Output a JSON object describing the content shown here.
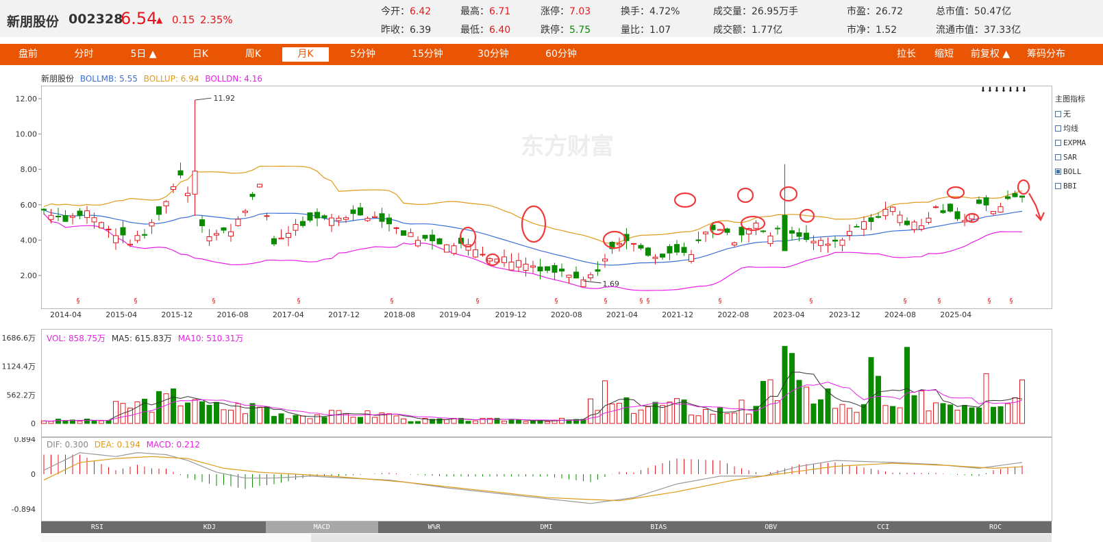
{
  "header": {
    "name": "新朋股份",
    "code": "002328",
    "price": "6.54",
    "arrow": "▲",
    "change": "0.15",
    "change_pct": "2.35%",
    "quotes": [
      {
        "label": "今开：",
        "value": "6.42",
        "color": "red"
      },
      {
        "label": "最高：",
        "value": "6.71",
        "color": "red"
      },
      {
        "label": "涨停：",
        "value": "7.03",
        "color": "red"
      },
      {
        "label": "换手：",
        "value": "4.72%",
        "color": "plain"
      },
      {
        "label": "成交量：",
        "value": "26.95万手",
        "color": "plain"
      },
      {
        "label": "市盈：",
        "value": "26.72",
        "color": "plain"
      },
      {
        "label": "总市值：",
        "value": "50.47亿",
        "color": "plain"
      },
      {
        "label": "昨收：",
        "value": "6.39",
        "color": "plain"
      },
      {
        "label": "最低：",
        "value": "6.40",
        "color": "red"
      },
      {
        "label": "跌停：",
        "value": "5.75",
        "color": "green"
      },
      {
        "label": "量比：",
        "value": "1.07",
        "color": "plain"
      },
      {
        "label": "成交额：",
        "value": "1.77亿",
        "color": "plain"
      },
      {
        "label": "市净：",
        "value": "1.52",
        "color": "plain"
      },
      {
        "label": "流通市值：",
        "value": "37.33亿",
        "color": "plain"
      }
    ]
  },
  "tabs": [
    "盘前",
    "分时",
    "5日 ▲",
    "日K",
    "周K",
    "月K",
    "5分钟",
    "15分钟",
    "30分钟",
    "60分钟"
  ],
  "active_tab": "月K",
  "right_tabs": [
    "拉长",
    "缩短",
    "前复权 ▲",
    "筹码分布"
  ],
  "main_legend": {
    "name": "新朋股份",
    "mb": "BOLLMB: 5.55",
    "up": "BOLLUP: 6.94",
    "dn": "BOLLDN: 4.16"
  },
  "watermark": "东方财富",
  "main_chart": {
    "y_ticks": [
      "12.00",
      "10.00",
      "8.00",
      "6.00",
      "4.00",
      "2.00"
    ],
    "x_ticks": [
      "2014-04",
      "2015-04",
      "2015-12",
      "2016-08",
      "2017-04",
      "2017-12",
      "2018-08",
      "2019-04",
      "2019-12",
      "2020-08",
      "2021-04",
      "2021-12",
      "2022-08",
      "2023-04",
      "2023-12",
      "2024-08",
      "2025-04"
    ],
    "high_label": "11.92",
    "low_label": "1.69"
  },
  "indicator_panel": {
    "title": "主图指标",
    "items": [
      {
        "label": "无",
        "checked": false
      },
      {
        "label": "均线",
        "checked": false
      },
      {
        "label": "EXPMA",
        "checked": false
      },
      {
        "label": "SAR",
        "checked": false
      },
      {
        "label": "BOLL",
        "checked": true
      },
      {
        "label": "BBI",
        "checked": false
      }
    ]
  },
  "vol_legend": {
    "vol": "VOL: 858.75万",
    "ma5": "MA5: 615.83万",
    "ma10": "MA10: 510.31万"
  },
  "vol_chart": {
    "y_ticks": [
      "1686.6万",
      "1124.4万",
      "562.2万",
      "0"
    ]
  },
  "macd_legend": {
    "dif": "DIF: 0.300",
    "dea": "DEA: 0.194",
    "macd": "MACD: 0.212"
  },
  "macd_chart": {
    "y_ticks": [
      "0.894",
      "0",
      "-0.894"
    ]
  },
  "indicator_tabs": [
    "RSI",
    "KDJ",
    "MACD",
    "W%R",
    "DMI",
    "BIAS",
    "OBV",
    "CCI",
    "ROC"
  ],
  "active_indicator": "MACD",
  "colors": {
    "up": "#e3171d",
    "down": "#0b8a00",
    "mb": "#3b6fd6",
    "up_band": "#e09a1a",
    "dn_band": "#e81ee8",
    "tabbar": "#ea5504"
  }
}
